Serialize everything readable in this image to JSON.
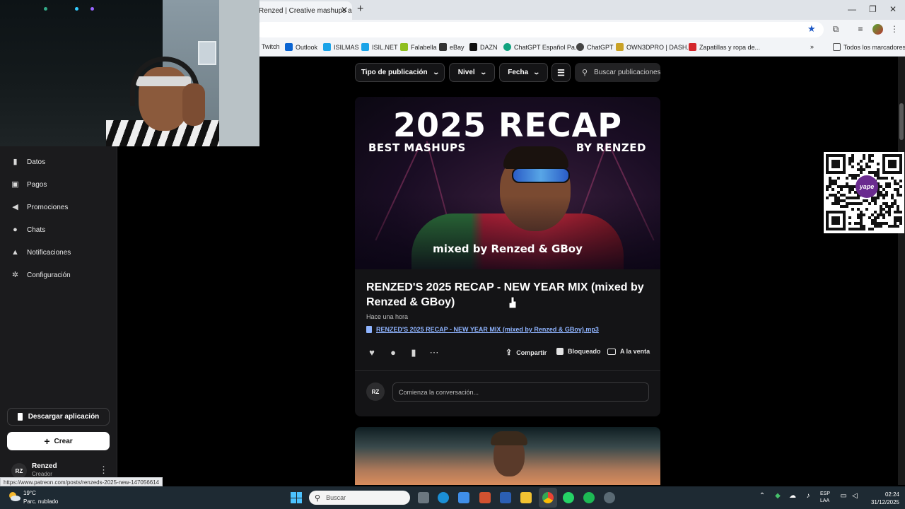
{
  "browser": {
    "tab_title": "Renzed | Creative mashups and",
    "bookmarks": [
      {
        "label": "Twitch",
        "color": "#9146ff"
      },
      {
        "label": "Outlook",
        "color": "#0a64d2"
      },
      {
        "label": "ISILMAS",
        "color": "#1aa3e8"
      },
      {
        "label": "ISIL.NET",
        "color": "#1aa3e8"
      },
      {
        "label": "Falabella",
        "color": "#8fbf1f"
      },
      {
        "label": "eBay",
        "color": "#333333"
      },
      {
        "label": "DAZN",
        "color": "#111111"
      },
      {
        "label": "ChatGPT Español Pa...",
        "color": "#10a37f"
      },
      {
        "label": "ChatGPT",
        "color": "#444444"
      },
      {
        "label": "OWN3DPRO | DASH...",
        "color": "#c9a227"
      },
      {
        "label": "Zapatillas y ropa de...",
        "color": "#d4262b"
      }
    ],
    "all_bookmarks": "Todos los marcadores",
    "status_url": "https://www.patreon.com/posts/renzeds-2025-new-147056614"
  },
  "sidebar": {
    "items": [
      {
        "label": "Datos",
        "icon": "bar-chart-icon"
      },
      {
        "label": "Pagos",
        "icon": "payments-icon"
      },
      {
        "label": "Promociones",
        "icon": "megaphone-icon"
      },
      {
        "label": "Chats",
        "icon": "chat-icon"
      },
      {
        "label": "Notificaciones",
        "icon": "bell-icon"
      },
      {
        "label": "Configuración",
        "icon": "gear-icon"
      }
    ],
    "download_label": "Descargar aplicación",
    "create_label": "Crear",
    "user_name": "Renzed",
    "user_role": "Creador",
    "user_initials": "RZ"
  },
  "filters": {
    "type": "Tipo de publicación",
    "level": "Nivel",
    "date": "Fecha",
    "search_placeholder": "Buscar publicaciones"
  },
  "post": {
    "cover_title": "2025 RECAP",
    "cover_left": "BEST MASHUPS",
    "cover_right": "BY RENZED",
    "cover_bottom": "mixed by Renzed & GBoy",
    "title": "RENZED'S 2025 RECAP - NEW YEAR MIX (mixed by Renzed & GBoy)",
    "time": "Hace una hora",
    "file": "RENZED'S 2025 RECAP - NEW YEAR MIX (mixed by Renzed & GBoy).mp3",
    "share": "Compartir",
    "locked": "Bloqueado",
    "for_sale": "A la venta",
    "comment_placeholder": "Comienza la conversación..."
  },
  "qr": {
    "brand": "yape"
  },
  "taskbar": {
    "temp": "19°C",
    "weather": "Parc. nublado",
    "search": "Buscar",
    "lang1": "ESP",
    "lang2": "LAA",
    "time": "02:24",
    "date": "31/12/2025"
  }
}
